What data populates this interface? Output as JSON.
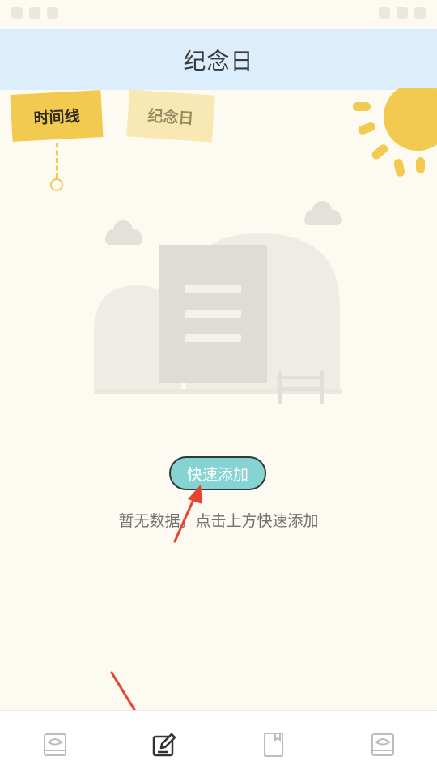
{
  "header": {
    "title": "纪念日"
  },
  "tabs": [
    {
      "label": "时间线",
      "active": true
    },
    {
      "label": "纪念日",
      "active": false
    }
  ],
  "empty_state": {
    "button_label": "快速添加",
    "message": "暂无数据，点击上方快速添加"
  },
  "bottom_nav": [
    {
      "icon": "notebook-eye-icon",
      "active": false
    },
    {
      "icon": "edit-icon",
      "active": true
    },
    {
      "icon": "book-icon",
      "active": false
    },
    {
      "icon": "notebook-eye-icon",
      "active": false
    }
  ],
  "colors": {
    "header_bg": "#dcedfb",
    "page_bg": "#fdfaf1",
    "accent_yellow": "#f2ca50",
    "button_teal": "#85d3d3",
    "arrow_red": "#e8432f"
  }
}
